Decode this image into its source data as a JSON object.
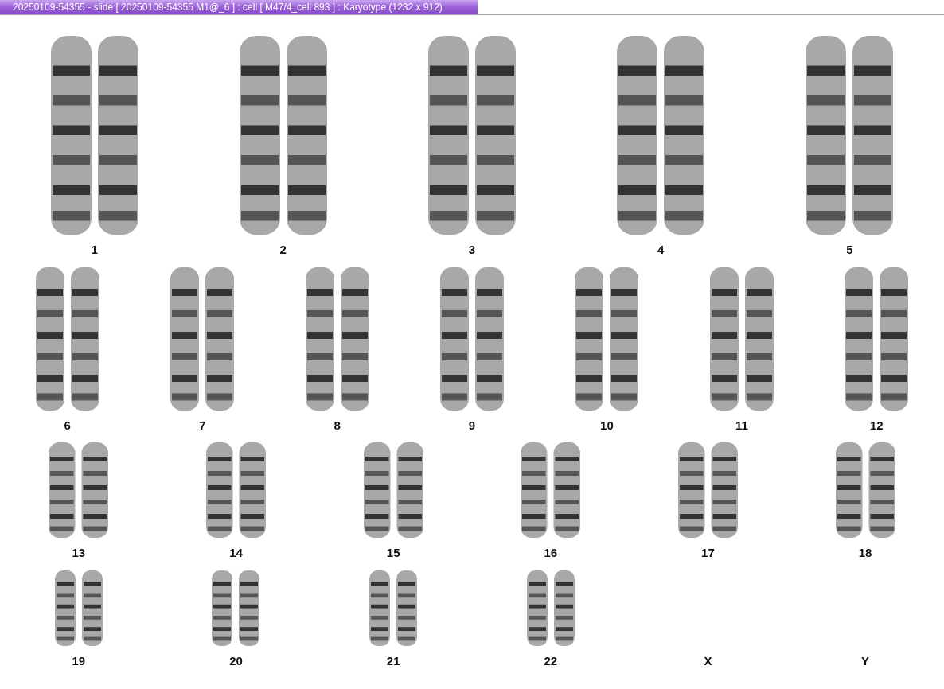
{
  "window": {
    "title": "20250109-54355 - slide [ 20250109-54355 M1@_6 ] : cell [ M47/4_cell 893 ] : Karyotype  (1232 x 912)"
  },
  "karyotype": {
    "rows": [
      {
        "cells": [
          {
            "label": "1",
            "present": true
          },
          {
            "label": "2",
            "present": true
          },
          {
            "label": "3",
            "present": true
          },
          {
            "label": "4",
            "present": true
          },
          {
            "label": "5",
            "present": true
          }
        ]
      },
      {
        "cells": [
          {
            "label": "6",
            "present": true
          },
          {
            "label": "7",
            "present": true
          },
          {
            "label": "8",
            "present": true
          },
          {
            "label": "9",
            "present": true
          },
          {
            "label": "10",
            "present": true
          },
          {
            "label": "11",
            "present": true
          },
          {
            "label": "12",
            "present": true
          }
        ]
      },
      {
        "cells": [
          {
            "label": "13",
            "present": true
          },
          {
            "label": "14",
            "present": true
          },
          {
            "label": "15",
            "present": true
          },
          {
            "label": "16",
            "present": true
          },
          {
            "label": "17",
            "present": true
          },
          {
            "label": "18",
            "present": true
          }
        ]
      },
      {
        "cells": [
          {
            "label": "19",
            "present": true
          },
          {
            "label": "20",
            "present": true
          },
          {
            "label": "21",
            "present": true
          },
          {
            "label": "22",
            "present": true
          },
          {
            "label": "X",
            "present": false
          },
          {
            "label": "Y",
            "present": false
          }
        ]
      }
    ]
  }
}
